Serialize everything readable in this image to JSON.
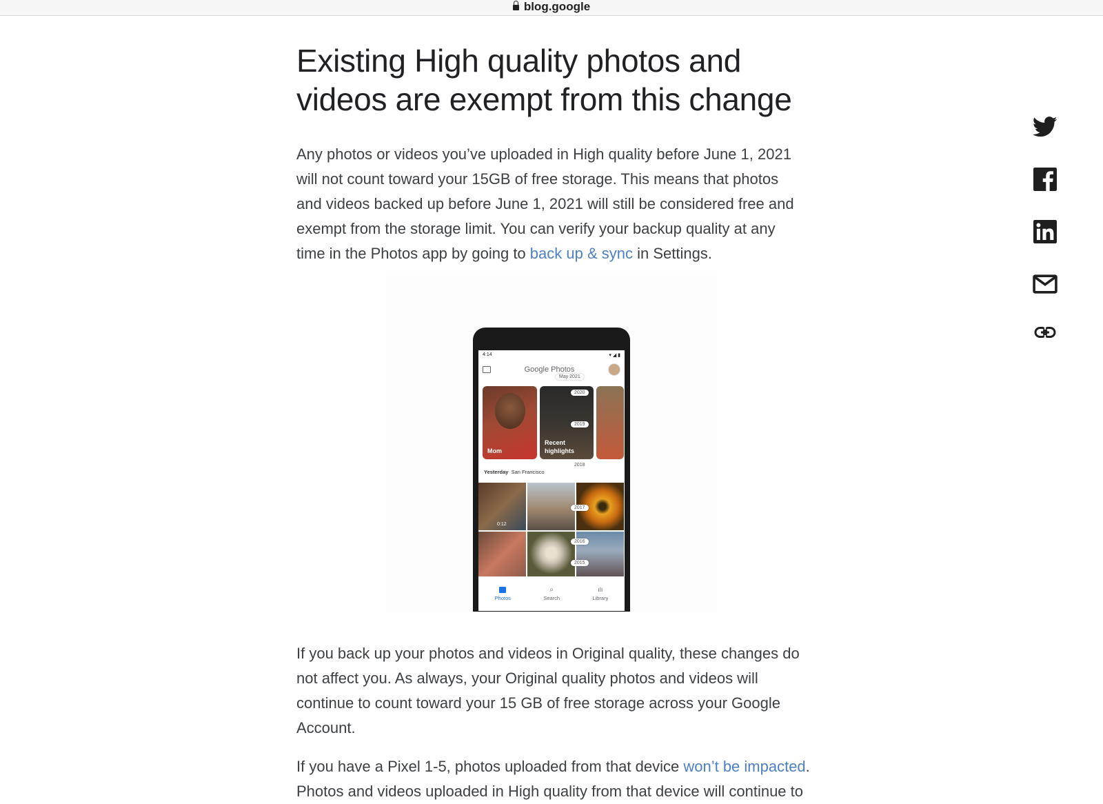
{
  "browser": {
    "domain": "blog.google"
  },
  "article": {
    "heading": "Existing High quality photos and videos are exempt from this change",
    "p1_text": "Any photos or videos you’ve uploaded in High quality before June 1, 2021 will not count toward your 15GB of free storage. This means that photos and videos backed up before June 1, 2021 will still be considered free and exempt from the storage limit. You can verify your backup quality at any time in the Photos app by going to ",
    "p1_link": "back up & sync",
    "p1_tail": " in Settings.",
    "p2_text": "If you back up your photos and videos in Original quality, these changes do not affect you. As always, your Original quality photos and videos will continue to count toward your 15 GB of free storage across your Google Account.",
    "p3_text": "If you have a Pixel 1-5, photos uploaded from that device ",
    "p3_link": "won’t be impacted",
    "p3_tail": ".",
    "p3_line2": "Photos and videos uploaded in High quality from that device will continue to"
  },
  "phone": {
    "time": "4:14",
    "app_title": "Google Photos",
    "chip_month": "May 2021",
    "years": [
      "2020",
      "2019",
      "2018",
      "2017",
      "2016",
      "2015"
    ],
    "memories": [
      {
        "label": "Mom"
      },
      {
        "label": "Recent\nhighlights"
      }
    ],
    "date_label": "Yesterday",
    "date_place": "San Francisco",
    "video_duration": "0:12",
    "nav": [
      {
        "label": "Photos"
      },
      {
        "label": "Search"
      },
      {
        "label": "Library"
      }
    ]
  },
  "share": {
    "icons": [
      "twitter-icon",
      "facebook-icon",
      "linkedin-icon",
      "mail-icon",
      "link-icon"
    ]
  },
  "colors": {
    "link": "#4d7fc4",
    "text": "#3c4043",
    "heading": "#202124",
    "share_icon": "#1f1f1f"
  }
}
